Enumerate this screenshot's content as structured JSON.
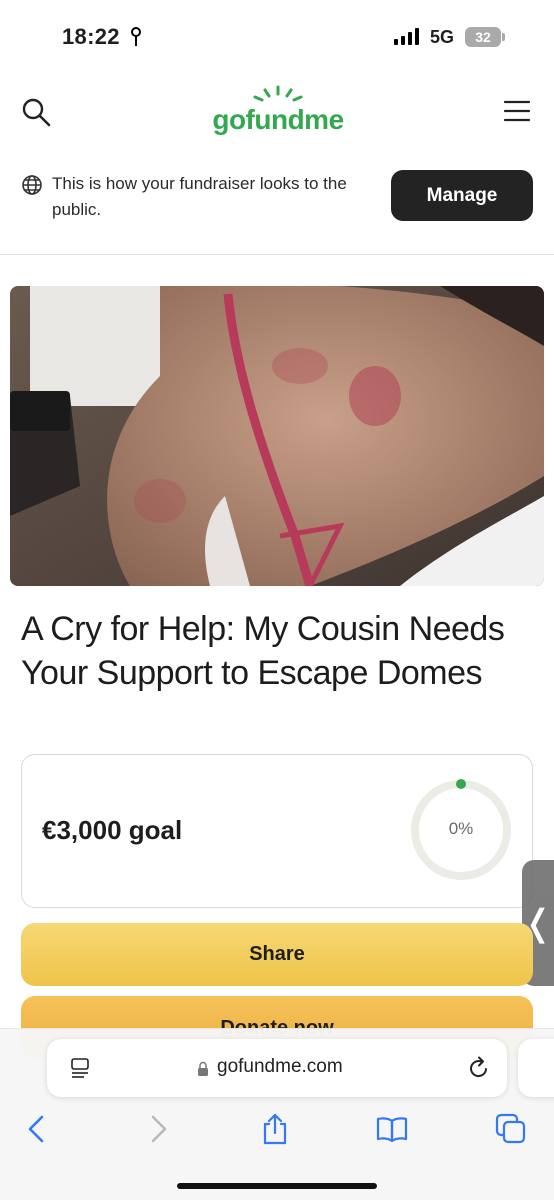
{
  "status_bar": {
    "time": "18:22",
    "network": "5G",
    "battery": "32"
  },
  "header": {
    "logo_text": "gofundme"
  },
  "banner": {
    "message": "This is how your fundraiser looks to the public.",
    "manage_label": "Manage"
  },
  "campaign": {
    "title": "A Cry for Help: My Cousin Needs Your Support to Escape Domes",
    "goal_text": "€3,000 goal",
    "progress_percent": 0,
    "progress_label": "0%"
  },
  "actions": {
    "share_label": "Share",
    "donate_label": "Donate now"
  },
  "browser": {
    "url": "gofundme.com"
  },
  "icons": {
    "search": "search-icon",
    "menu": "menu-icon",
    "globe": "globe-icon",
    "reader": "reader-mode-icon",
    "lock": "lock-icon",
    "reload": "reload-icon",
    "back": "back-arrow-icon",
    "forward": "forward-arrow-icon",
    "share": "share-icon",
    "bookmarks": "bookmarks-icon",
    "tabs": "tabs-icon"
  },
  "colors": {
    "brand_green": "#34a84e",
    "share_yellow": "#f2cb5a",
    "donate_orange": "#f0b548",
    "manage_dark": "#232323",
    "ios_blue": "#3478f6"
  }
}
